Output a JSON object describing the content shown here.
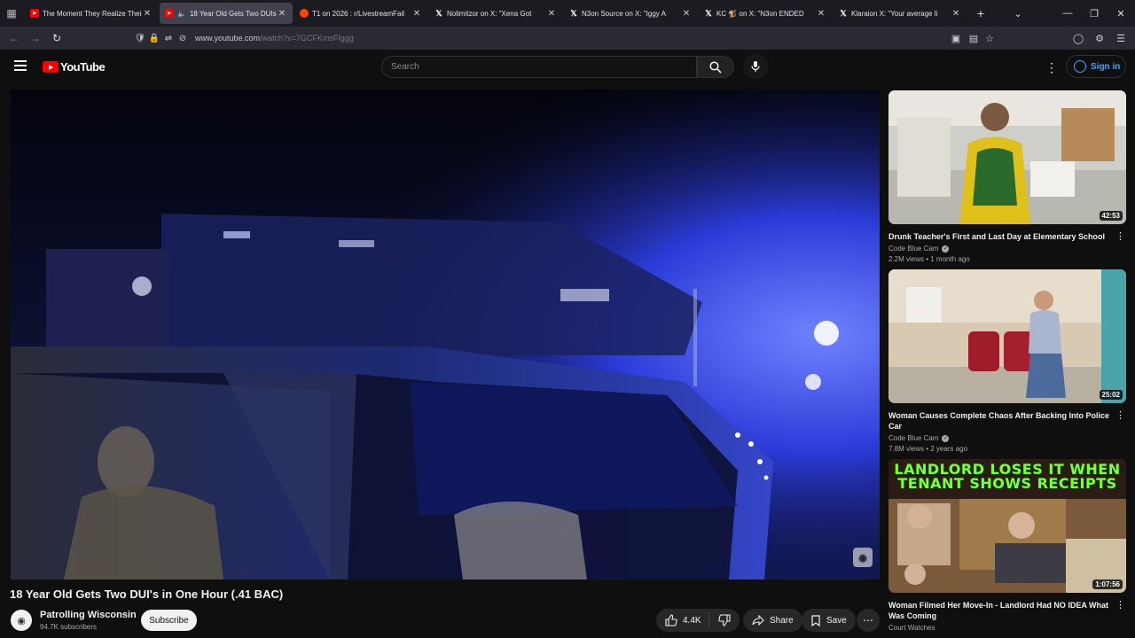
{
  "browser": {
    "tabs": [
      {
        "title": "The Moment They Realize Their",
        "icon": "youtube-icon",
        "active": false
      },
      {
        "title": "18 Year Old Gets Two DUIs",
        "icon": "youtube-icon",
        "active": true,
        "muted": true
      },
      {
        "title": "T1 on 2026 : r/LivestreamFail",
        "icon": "reddit-icon",
        "active": false
      },
      {
        "title": "Nolimitzor on X: \"Xena Got",
        "icon": "x-icon",
        "active": false
      },
      {
        "title": "N3on Source on X: \"Iggy A",
        "icon": "x-icon",
        "active": false
      },
      {
        "title": "KC 🐒 on X: \"N3on ENDED",
        "icon": "x-icon",
        "active": false
      },
      {
        "title": "Klaraion X: \"Your average li",
        "icon": "x-icon",
        "active": false
      }
    ],
    "url_domain": "www.youtube.com",
    "url_path": "/watch?v=7GCFKmsFIggg"
  },
  "youtube": {
    "logo_text": "YouTube",
    "search_placeholder": "Search",
    "signin_label": "Sign in"
  },
  "video": {
    "title": "18 Year Old Gets Two DUI's in One Hour (.41 BAC)",
    "channel": "Patrolling Wisconsin",
    "subscribers": "94.7K subscribers",
    "subscribe_label": "Subscribe",
    "likes": "4.4K",
    "share_label": "Share",
    "save_label": "Save",
    "more_label": "⋯"
  },
  "recommended": [
    {
      "title": "Drunk Teacher's First and Last Day at Elementary School",
      "channel": "Code Blue Cam",
      "verified": true,
      "meta": "2.2M views • 1 month ago",
      "duration": "42:53"
    },
    {
      "title": "Woman Causes Complete Chaos After Backing Into Police Car",
      "channel": "Code Blue Cam",
      "verified": true,
      "meta": "7.8M views • 2 years ago",
      "duration": "25:02"
    },
    {
      "title": "Woman Filmed Her Move-In - Landlord Had NO IDEA What Was Coming",
      "channel": "Court Watches",
      "verified": false,
      "meta": "",
      "duration": "1:07:56",
      "thumb_text_1": "LANDLORD LOSES IT WHEN",
      "thumb_text_2": "TENANT SHOWS RECEIPTS"
    }
  ]
}
